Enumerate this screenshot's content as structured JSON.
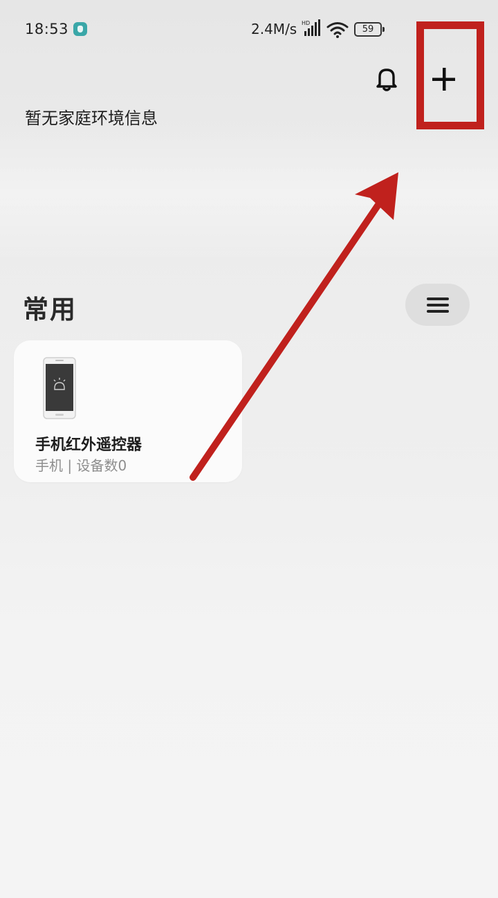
{
  "status_bar": {
    "time": "18:53",
    "network_speed": "2.4M/s",
    "signal_badge": "HD",
    "battery_level": "59",
    "icons": [
      "app-notification-icon",
      "cellular-signal-icon",
      "wifi-icon",
      "battery-icon"
    ]
  },
  "header": {
    "home_info": "暂无家庭环境信息",
    "icons": [
      "bell-icon",
      "plus-icon"
    ]
  },
  "section": {
    "title": "常用",
    "menu_icon": "hamburger-menu-icon"
  },
  "devices": [
    {
      "name": "手机红外遥控器",
      "subtitle": "手机 | 设备数0",
      "icon": "phone-icon"
    }
  ],
  "annotation": {
    "color": "#c0211d",
    "target": "add-button"
  },
  "colors": {
    "accent_annotation": "#c0211d",
    "status_app_icon": "#3aa7a8",
    "card_background": "#fbfbfb",
    "menu_button_background": "#dedede"
  }
}
